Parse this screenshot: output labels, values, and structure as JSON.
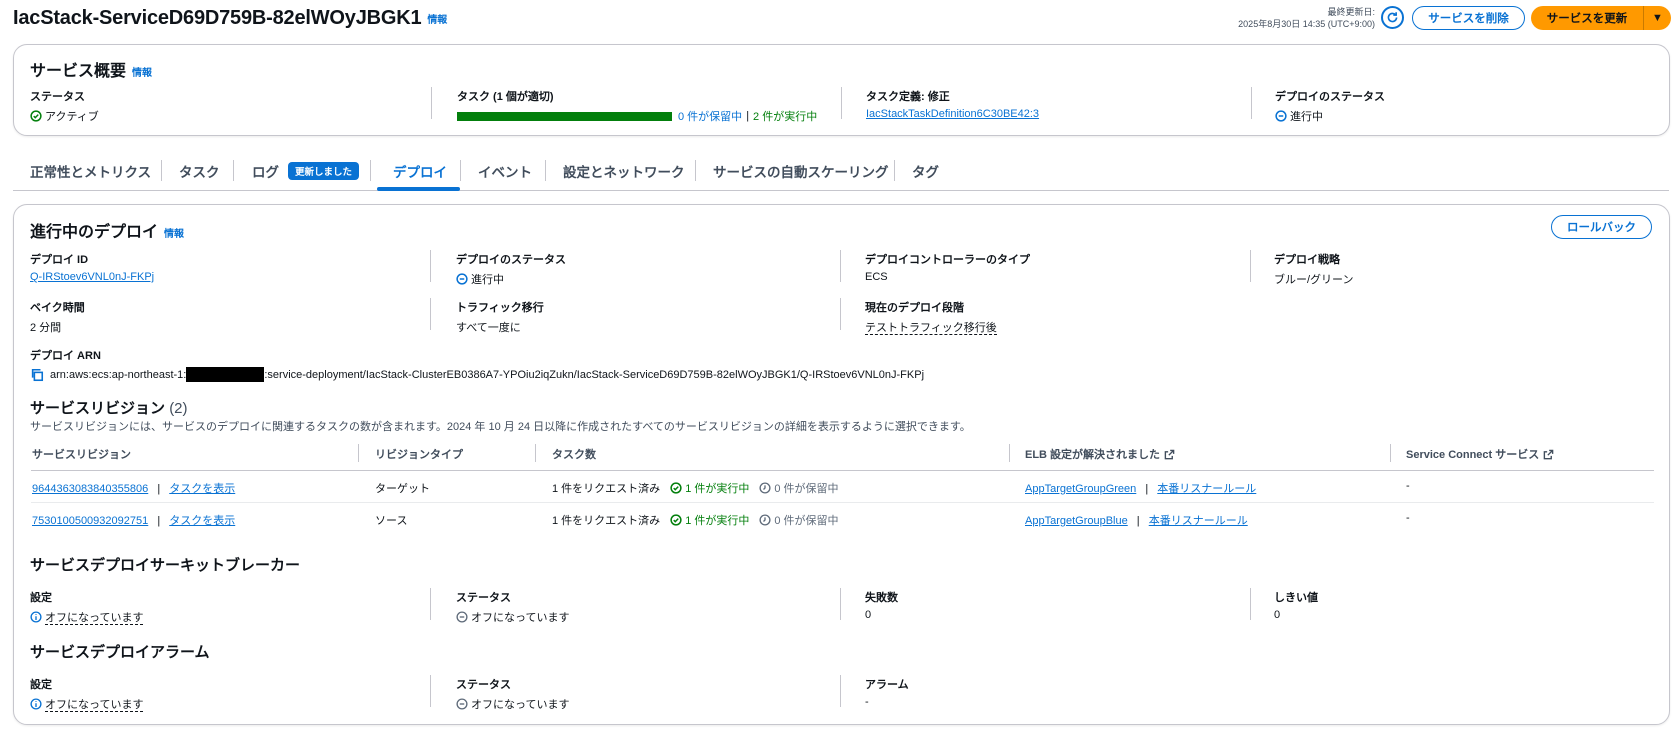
{
  "header": {
    "title": "IacStack-ServiceD69D759B-82elWOyJBGK1",
    "info": "情報",
    "last_updated_label": "最終更新日:",
    "last_updated_value": "2025年8月30日 14:35 (UTC+9:00)",
    "delete_button": "サービスを削除",
    "update_button": "サービスを更新"
  },
  "overview": {
    "title": "サービス概要",
    "info": "情報",
    "status_label": "ステータス",
    "status_value": "アクティブ",
    "tasks_label": "タスク (1 個が適切)",
    "tasks_progress": 1.0,
    "tasks_pending": "0 件が保留中",
    "tasks_running": "2 件が実行中",
    "taskdef_label": "タスク定義: 修正",
    "taskdef_value": "IacStackTaskDefinition6C30BE42:3",
    "deploy_status_label": "デプロイのステータス",
    "deploy_status_value": "進行中"
  },
  "tabs": [
    {
      "label": "正常性とメトリクス"
    },
    {
      "label": "タスク"
    },
    {
      "label": "ログ",
      "badge": "更新しました"
    },
    {
      "label": "デプロイ",
      "active": true
    },
    {
      "label": "イベント"
    },
    {
      "label": "設定とネットワーク"
    },
    {
      "label": "サービスの自動スケーリング"
    },
    {
      "label": "タグ"
    }
  ],
  "deployment": {
    "title": "進行中のデプロイ",
    "info": "情報",
    "rollback_button": "ロールバック",
    "id_label": "デプロイ ID",
    "id_value": "Q-IRStoev6VNL0nJ-FKPj",
    "status_label": "デプロイのステータス",
    "status_value": "進行中",
    "controller_label": "デプロイコントローラーのタイプ",
    "controller_value": "ECS",
    "strategy_label": "デプロイ戦略",
    "strategy_value": "ブルー/グリーン",
    "bake_label": "ベイク時間",
    "bake_value": "2 分間",
    "traffic_label": "トラフィック移行",
    "traffic_value": "すべて一度に",
    "phase_label": "現在のデプロイ段階",
    "phase_value": "テストトラフィック移行後",
    "arn_label": "デプロイ ARN",
    "arn_prefix": "arn:aws:ecs:ap-northeast-1:",
    "arn_suffix": ":service-deployment/IacStack-ClusterEB0386A7-YPOiu2iqZukn/IacStack-ServiceD69D759B-82elWOyJBGK1/Q-IRStoev6VNL0nJ-FKPj"
  },
  "revisions": {
    "title": "サービスリビジョン",
    "count": "(2)",
    "description": "サービスリビジョンには、サービスのデプロイに関連するタスクの数が含まれます。2024 年 10 月 24 日以降に作成されたすべてのサービスリビジョンの詳細を表示するように選択できます。",
    "columns": [
      "サービスリビジョン",
      "リビジョンタイプ",
      "タスク数",
      "ELB 設定が解決されました",
      "Service Connect サービス"
    ],
    "rows": [
      {
        "revision": "9644363083840355806",
        "view_tasks": "タスクを表示",
        "type": "ターゲット",
        "requested": "1 件をリクエスト済み",
        "running": "1 件が実行中",
        "pending": "0 件が保留中",
        "tg": "AppTargetGroupGreen",
        "listener": "本番リスナールール",
        "sc": "-"
      },
      {
        "revision": "7530100500932092751",
        "view_tasks": "タスクを表示",
        "type": "ソース",
        "requested": "1 件をリクエスト済み",
        "running": "1 件が実行中",
        "pending": "0 件が保留中",
        "tg": "AppTargetGroupBlue",
        "listener": "本番リスナールール",
        "sc": "-"
      }
    ]
  },
  "circuit_breaker": {
    "title": "サービスデプロイサーキットブレーカー",
    "setting_label": "設定",
    "setting_value": "オフになっています",
    "status_label": "ステータス",
    "status_value": "オフになっています",
    "failures_label": "失敗数",
    "failures_value": "0",
    "threshold_label": "しきい値",
    "threshold_value": "0"
  },
  "alarms": {
    "title": "サービスデプロイアラーム",
    "setting_label": "設定",
    "setting_value": "オフになっています",
    "status_label": "ステータス",
    "status_value": "オフになっています",
    "alarm_label": "アラーム",
    "alarm_value": "-"
  },
  "colors": {
    "link": "#0972d3",
    "success": "#037f0c",
    "primary_button": "#ff9900",
    "border": "#c6c6cd"
  }
}
